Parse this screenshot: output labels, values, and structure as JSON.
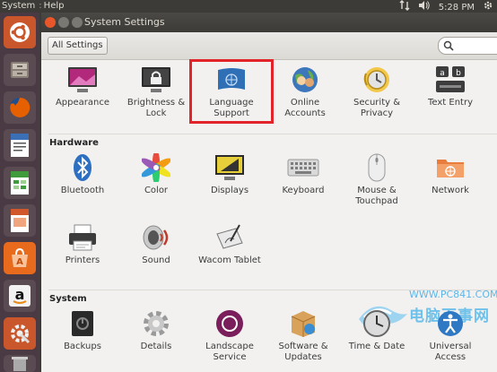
{
  "topbar": {
    "app_menu": "System",
    "help_menu": "Help",
    "time": "5:28 PM"
  },
  "window": {
    "title": "System Settings",
    "all_settings": "All Settings"
  },
  "sections": {
    "personal": {
      "items": [
        {
          "label": "Appearance",
          "icon": "appearance-icon"
        },
        {
          "label": "Brightness &\nLock",
          "icon": "lock-icon"
        },
        {
          "label": "Language\nSupport",
          "icon": "language-icon"
        },
        {
          "label": "Online\nAccounts",
          "icon": "online-accounts-icon"
        },
        {
          "label": "Security &\nPrivacy",
          "icon": "security-icon"
        },
        {
          "label": "Text Entry",
          "icon": "keyboard-layout-icon"
        }
      ]
    },
    "hardware": {
      "title": "Hardware",
      "items": [
        {
          "label": "Bluetooth",
          "icon": "bluetooth-icon"
        },
        {
          "label": "Color",
          "icon": "color-icon"
        },
        {
          "label": "Displays",
          "icon": "display-icon"
        },
        {
          "label": "Keyboard",
          "icon": "keyboard-icon"
        },
        {
          "label": "Mouse &\nTouchpad",
          "icon": "mouse-icon"
        },
        {
          "label": "Network",
          "icon": "network-icon"
        },
        {
          "label": "Printers",
          "icon": "printer-icon"
        },
        {
          "label": "Sound",
          "icon": "sound-icon"
        },
        {
          "label": "Wacom Tablet",
          "icon": "tablet-icon"
        }
      ]
    },
    "system": {
      "title": "System",
      "items": [
        {
          "label": "Backups",
          "icon": "backups-icon"
        },
        {
          "label": "Details",
          "icon": "gear-icon"
        },
        {
          "label": "Landscape\nService",
          "icon": "landscape-icon"
        },
        {
          "label": "Software &\nUpdates",
          "icon": "software-icon"
        },
        {
          "label": "Time & Date",
          "icon": "clock-icon"
        },
        {
          "label": "Universal\nAccess",
          "icon": "accessibility-icon"
        }
      ]
    }
  },
  "watermark": {
    "url": "WWW.PC841.COM",
    "name": "电脑百事网"
  },
  "colors": {
    "highlight_border": "#e2242a",
    "launcher_bg": "#4a3a44",
    "panel_bg": "#3c3b37"
  }
}
